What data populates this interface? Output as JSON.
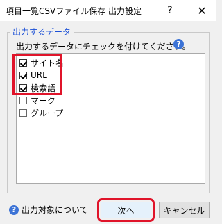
{
  "window": {
    "title": "項目一覧CSVファイル保存 出力設定",
    "help_glyph": "?",
    "close_glyph": "✕"
  },
  "output_group": {
    "legend": "出力するデータ",
    "description": "出力するデータにチェックを付けてください。",
    "help_glyph": "?",
    "items": [
      {
        "label": "サイト名",
        "checked": true
      },
      {
        "label": "URL",
        "checked": true
      },
      {
        "label": "検索語",
        "checked": true
      },
      {
        "label": "マーク",
        "checked": false
      },
      {
        "label": "グループ",
        "checked": false
      }
    ]
  },
  "footer": {
    "help_glyph": "?",
    "help_link": "出力対象について",
    "next_label": "次へ",
    "cancel_label": "キャンセル"
  },
  "colors": {
    "accent": "#1a4fd6",
    "highlight": "#e0142a"
  }
}
